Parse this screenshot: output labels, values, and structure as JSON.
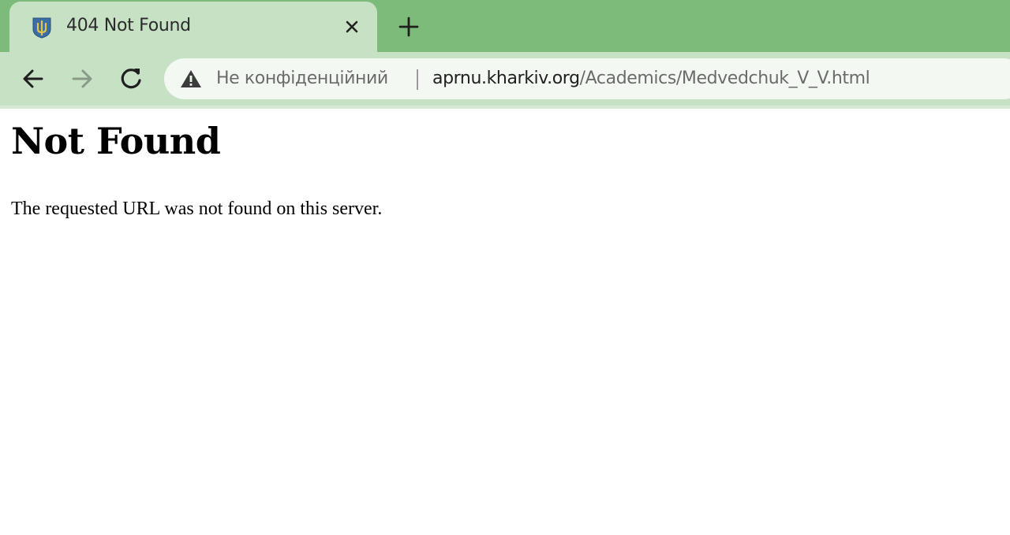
{
  "tab": {
    "title": "404 Not Found",
    "favicon": "coat-of-arms-icon",
    "close_icon": "close-icon"
  },
  "tab_strip": {
    "new_tab_icon": "plus-icon"
  },
  "toolbar": {
    "back_icon": "arrow-left-icon",
    "forward_icon": "arrow-right-icon",
    "reload_icon": "reload-icon"
  },
  "omnibox": {
    "security_icon": "warning-icon",
    "security_label": "Не конфіденційний",
    "url_domain": "aprnu.kharkiv.org",
    "url_path": "/Academics/Medvedchuk_V_V.html"
  },
  "page": {
    "heading": "Not Found",
    "message": "The requested URL was not found on this server."
  },
  "colors": {
    "tab_strip_bg": "#7dbb7b",
    "active_tab_bg": "#c6e1c3",
    "omnibox_bg": "#f3f8f2",
    "page_bg": "#ffffff"
  }
}
